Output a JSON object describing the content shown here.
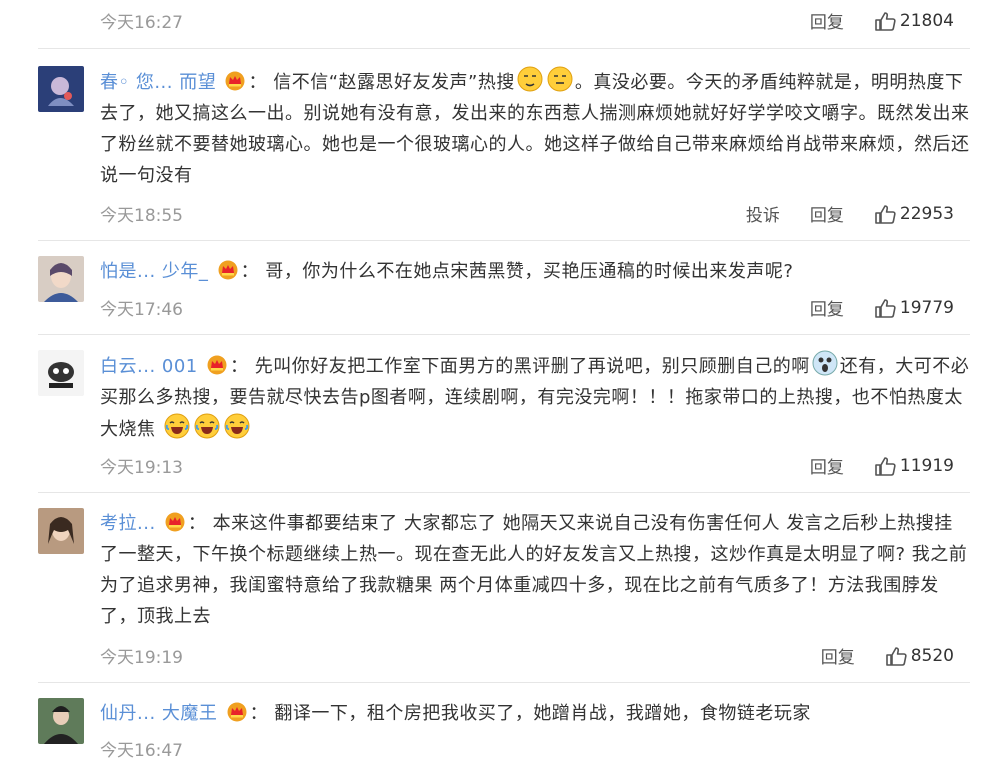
{
  "top": {
    "time": "今天16:27",
    "reply": "回复",
    "likes": "21804"
  },
  "comments": [
    {
      "username": "春◦ 您... 而望",
      "text_a": "信不信“赵露思好友发声”热搜",
      "text_b": "。真没必要。今天的矛盾纯粹就是，明明热度下去了，她又搞这么一出。别说她有没有意，发出来的东西惹人揣测麻烦她就好好学学咬文嚼字。既然发出来了粉丝就不要替她玻璃心。她也是一个很玻璃心的人。她这样子做给自己带来麻烦给肖战带来麻烦，然后还说一句没有",
      "time": "今天18:55",
      "report": "投诉",
      "reply": "回复",
      "likes": "22953"
    },
    {
      "username": "怕是... 少年_",
      "text": "哥，你为什么不在她点宋茜黑赞，买艳压通稿的时候出来发声呢?",
      "time": "今天17:46",
      "reply": "回复",
      "likes": "19779"
    },
    {
      "username": "白云... 001",
      "text_a": "先叫你好友把工作室下面男方的黑评删了再说吧，别只顾删自己的啊",
      "text_b": "还有，大可不必买那么多热搜，要告就尽快去告p图者啊，连续剧啊，有完没完啊！！！拖家带口的上热搜，也不怕热度太大烧焦",
      "time": "今天19:13",
      "reply": "回复",
      "likes": "11919"
    },
    {
      "username": "考拉... ",
      "text": "本来这件事都要结束了 大家都忘了 她隔天又来说自己没有伤害任何人 发言之后秒上热搜挂了一整天，下午换个标题继续上热一。现在查无此人的好友发言又上热搜，这炒作真是太明显了啊? 我之前为了追求男神，我闺蜜特意给了我款糖果 两个月体重减四十多，现在比之前有气质多了！方法我围脖发了，顶我上去",
      "time": "今天19:19",
      "reply": "回复",
      "likes": "8520"
    },
    {
      "username": "仙丹... 大魔王",
      "text": "翻译一下，租个房把我收买了，她蹭肖战，我蹭她，食物链老玩家",
      "time": "今天16:47"
    }
  ],
  "sep": "："
}
